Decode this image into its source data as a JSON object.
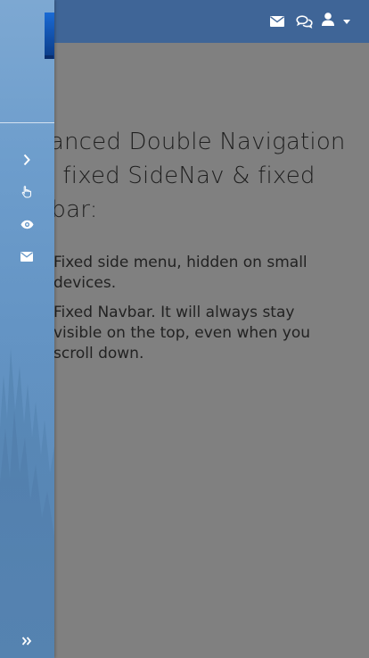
{
  "navbar": {
    "icons": [
      "envelope-icon",
      "comments-icon",
      "user-icon",
      "caret-down-icon"
    ]
  },
  "sidenav": {
    "items": [
      {
        "icon": "chevron-right-icon"
      },
      {
        "icon": "hand-pointer-icon"
      },
      {
        "icon": "eye-icon"
      },
      {
        "icon": "envelope-icon"
      }
    ],
    "footer_icon": "double-chevron-right-icon"
  },
  "main": {
    "heading": "Advanced Double Navigation with fixed SideNav & fixed Navbar:",
    "features": [
      "Fixed side menu, hidden on small devices.",
      "Fixed Navbar. It will always stay visible on the top, even when you scroll down."
    ]
  },
  "colors": {
    "navbar": "#3f6597",
    "sidenav": "#6d9dcc",
    "overlay": "#808080"
  }
}
